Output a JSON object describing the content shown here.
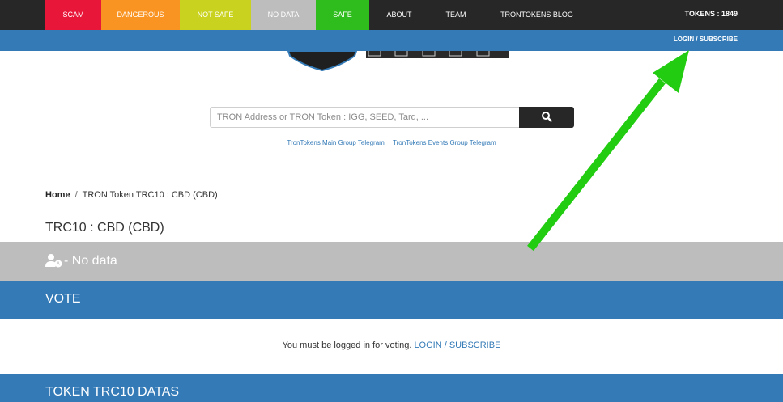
{
  "nav": {
    "items": [
      {
        "label": "SCAM",
        "color": "#e8173a"
      },
      {
        "label": "DANGEROUS",
        "color": "#f99321"
      },
      {
        "label": "NOT SAFE",
        "color": "#c9d21e"
      },
      {
        "label": "NO DATA",
        "color": "#bdbdbd"
      },
      {
        "label": "SAFE",
        "color": "#2fbd1d"
      },
      {
        "label": "ABOUT",
        "color": "#272727"
      },
      {
        "label": "TEAM",
        "color": "#272727"
      },
      {
        "label": "TRONTOKENS BLOG",
        "color": "#272727"
      }
    ],
    "tokens_count": "TOKENS : 1849"
  },
  "subbar": {
    "login_label": "LOGIN / SUBSCRIBE"
  },
  "logo": {
    "text": "TOKENS"
  },
  "search": {
    "placeholder": "TRON Address or TRON Token : IGG, SEED, Tarq, ...",
    "button_icon": "search-icon"
  },
  "telegram": {
    "main": "TronTokens Main Group Telegram",
    "events": "TronTokens Events Group Telegram"
  },
  "breadcrumb": {
    "home": "Home",
    "separator": "/",
    "current": "TRON Token TRC10 : CBD (CBD)"
  },
  "page_title": "TRC10 : CBD (CBD)",
  "status": {
    "icon": "user-clock-icon",
    "label": "- No data",
    "color": "#bdbdbd"
  },
  "vote": {
    "title": "VOTE",
    "message": "You must be logged in for voting.",
    "link": "LOGIN / SUBSCRIBE"
  },
  "datas": {
    "title": "TOKEN TRC10 DATAS"
  },
  "accent": {
    "blue": "#337ab7",
    "dark": "#272727",
    "arrow": "#22cc11"
  }
}
